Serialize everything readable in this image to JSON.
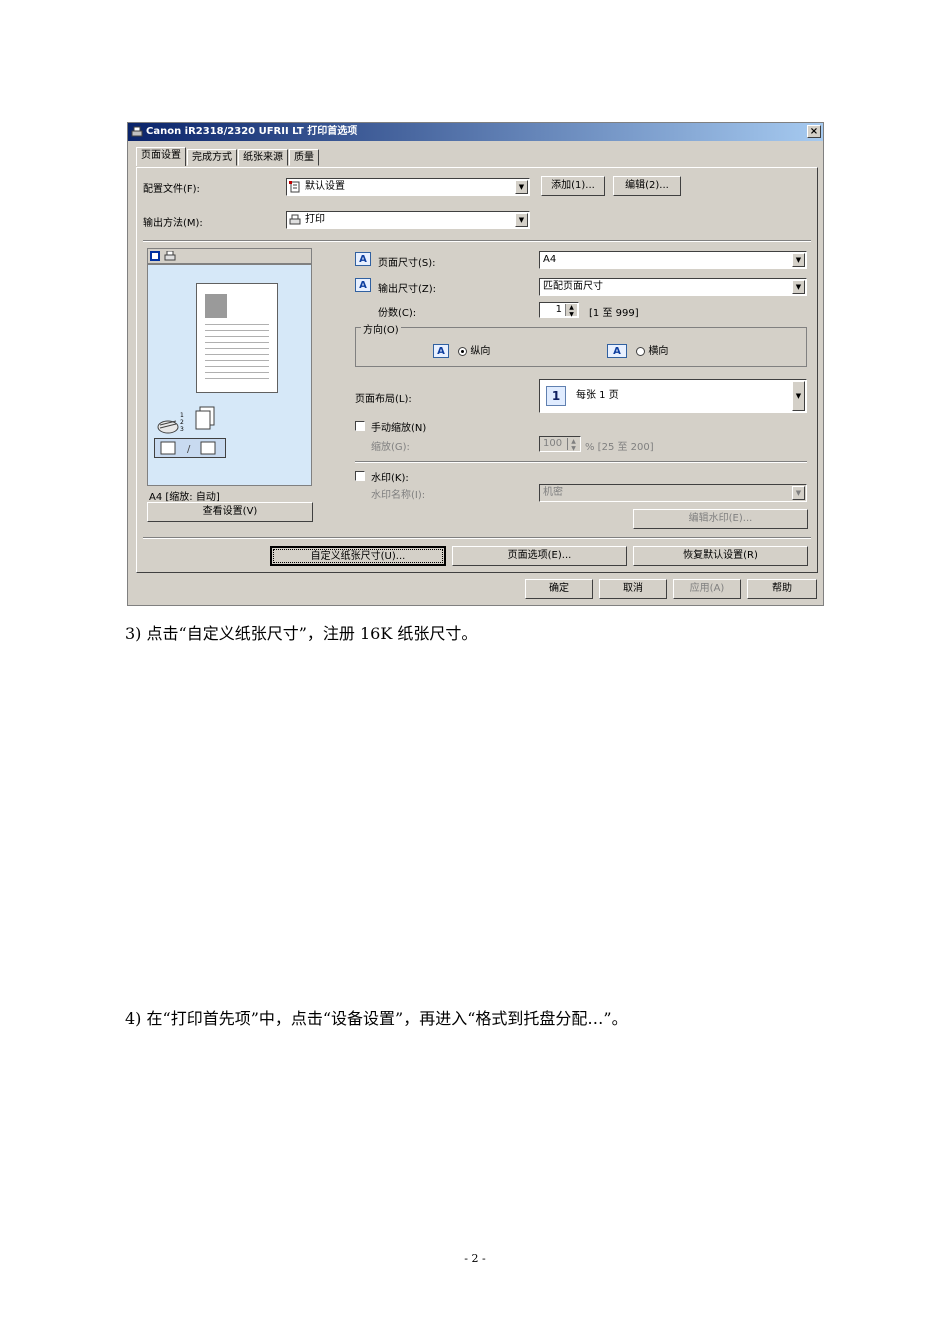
{
  "dialog": {
    "title": "Canon iR2318/2320 UFRII LT 打印首选项",
    "close_glyph": "×",
    "tabs": [
      "页面设置",
      "完成方式",
      "纸张来源",
      "质量"
    ],
    "profile_label": "配置文件(F):",
    "profile_value": "默认设置",
    "add_button": "添加(1)...",
    "edit_button": "编辑(2)...",
    "output_method_label": "输出方法(M):",
    "output_method_value": "打印",
    "preview_caption": "A4 [缩放: 自动]",
    "view_settings_button": "查看设置(V)",
    "page_size_label": "页面尺寸(S):",
    "page_size_value": "A4",
    "output_size_label": "输出尺寸(Z):",
    "output_size_value": "匹配页面尺寸",
    "copies_label": "份数(C):",
    "copies_value": "1",
    "copies_range": "[1 至 999]",
    "orientation_label": "方向(O)",
    "portrait_label": "纵向",
    "landscape_label": "横向",
    "page_layout_label": "页面布局(L):",
    "page_layout_number": "1",
    "page_layout_value": "每张 1 页",
    "manual_scaling_label": "手动缩放(N)",
    "scaling_label": "缩放(G):",
    "scaling_value": "100",
    "scaling_range": "% [25 至 200]",
    "watermark_label": "水印(K):",
    "watermark_name_label": "水印名称(I):",
    "watermark_name_value": "机密",
    "edit_watermark_button": "编辑水印(E)...",
    "custom_paper_button": "自定义纸张尺寸(U)...",
    "page_options_button": "页面选项(E)...",
    "restore_defaults_button": "恢复默认设置(R)",
    "ok_button": "确定",
    "cancel_button": "取消",
    "apply_button": "应用(A)",
    "help_button": "帮助"
  },
  "document": {
    "step3": "3)  点击“自定义纸张尺寸”，注册 16K 纸张尺寸。",
    "step4": "4)  在“打印首先项”中，点击“设备设置”，再进入“格式到托盘分配…”。",
    "page_number": "- 2 -"
  },
  "colors": {
    "titlebar": "#0a246a",
    "dialog_bg": "#d4d0c8",
    "preview_bg": "#d6e8f8"
  }
}
